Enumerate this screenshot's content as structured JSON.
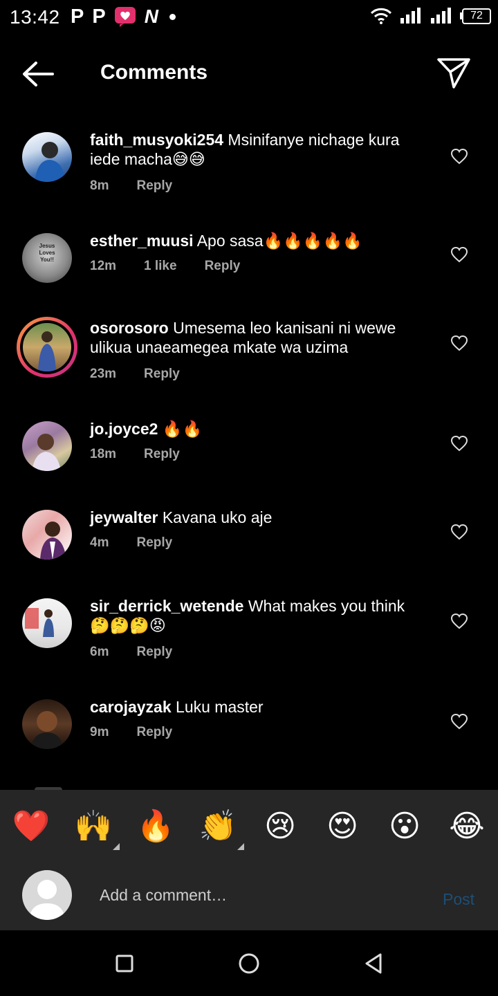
{
  "status_bar": {
    "time": "13:42",
    "left_icons": [
      "P",
      "P",
      "N"
    ],
    "battery": "72"
  },
  "header": {
    "title": "Comments"
  },
  "comments": [
    {
      "username": "faith_musyoki254",
      "text": "Msinifanye nichage kura iede macha😅😅",
      "time": "8m",
      "likes": "",
      "reply": "Reply"
    },
    {
      "username": "esther_muusi",
      "text": "Apo sasa🔥🔥🔥🔥🔥",
      "time": "12m",
      "likes": "1 like",
      "reply": "Reply",
      "avatar_text": "Jesus Loves You!!"
    },
    {
      "username": "osorosoro",
      "text": "Umesema leo kanisani ni wewe ulikua unaeamegea mkate wa uzima",
      "time": "23m",
      "likes": "",
      "reply": "Reply"
    },
    {
      "username": "jo.joyce2",
      "text": "🔥🔥",
      "time": "18m",
      "likes": "",
      "reply": "Reply"
    },
    {
      "username": "jeywalter",
      "text": "Kavana uko aje",
      "time": "4m",
      "likes": "",
      "reply": "Reply"
    },
    {
      "username": "sir_derrick_wetende",
      "text": "What makes you think 🤔🤔🤔😡",
      "time": "6m",
      "likes": "",
      "reply": "Reply"
    },
    {
      "username": "carojayzak",
      "text": "Luku master",
      "time": "9m",
      "likes": "",
      "reply": "Reply"
    }
  ],
  "reactions": [
    "❤️",
    "🙌",
    "🔥",
    "👏",
    "😢",
    "😍",
    "😮",
    "😂"
  ],
  "input": {
    "placeholder": "Add a comment…",
    "post_label": "Post"
  },
  "colors": {
    "background": "#000000",
    "bar": "#262626",
    "muted": "#a8a8a8",
    "post_disabled": "#1c4f78"
  }
}
